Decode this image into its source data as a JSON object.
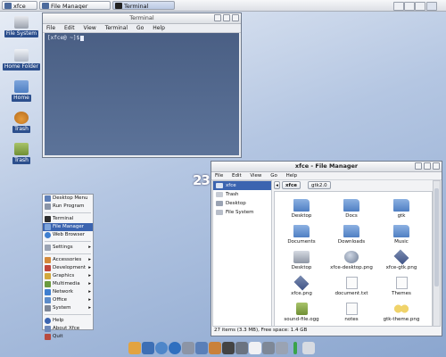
{
  "top_panel": {
    "tasks": [
      {
        "label": "xfce",
        "active": false
      },
      {
        "label": "File Manager",
        "active": false
      },
      {
        "label": "Terminal",
        "active": true
      }
    ]
  },
  "desktop": {
    "icons": [
      {
        "label": "File System",
        "icon": "drive-icon"
      },
      {
        "label": "Home Folder",
        "icon": "home-icon"
      },
      {
        "label": "Home",
        "icon": "folder-icon"
      },
      {
        "label": "Trash",
        "icon": "trash-icon"
      },
      {
        "label": "Trash",
        "icon": "trash-icon"
      }
    ],
    "logo_text": "23"
  },
  "terminal": {
    "title": "Terminal",
    "menu": [
      "File",
      "Edit",
      "View",
      "Terminal",
      "Go",
      "Help"
    ],
    "prompt": "[xfce@ ~]$"
  },
  "app_menu": {
    "items": [
      {
        "label": "Desktop Menu",
        "arrow": false
      },
      {
        "label": "Run Program",
        "arrow": false
      },
      {
        "label": "Terminal",
        "arrow": false
      },
      {
        "label": "File Manager",
        "arrow": false,
        "highlighted": true
      },
      {
        "label": "Web Browser",
        "arrow": false
      },
      {
        "label": "Settings",
        "arrow": true
      },
      {
        "label": "Accessories",
        "arrow": true
      },
      {
        "label": "Development",
        "arrow": true
      },
      {
        "label": "Graphics",
        "arrow": true
      },
      {
        "label": "Multimedia",
        "arrow": true
      },
      {
        "label": "Network",
        "arrow": true
      },
      {
        "label": "Office",
        "arrow": true
      },
      {
        "label": "System",
        "arrow": true
      },
      {
        "label": "Help",
        "arrow": false
      },
      {
        "label": "About Xfce",
        "arrow": false
      },
      {
        "label": "Quit",
        "arrow": false
      }
    ]
  },
  "file_manager": {
    "title": "xfce - File Manager",
    "menu": [
      "File",
      "Edit",
      "View",
      "Go",
      "Help"
    ],
    "sidebar": [
      {
        "label": "xfce",
        "selected": true
      },
      {
        "label": "Trash",
        "selected": false
      },
      {
        "label": "Desktop",
        "selected": false
      },
      {
        "label": "File System",
        "selected": false
      }
    ],
    "path_buttons": [
      "xfce",
      "gtk2.0"
    ],
    "files": [
      {
        "label": "Desktop",
        "type": "folder"
      },
      {
        "label": "Docs",
        "type": "folder"
      },
      {
        "label": "gtk",
        "type": "folder"
      },
      {
        "label": "Documents",
        "type": "folder"
      },
      {
        "label": "Downloads",
        "type": "folder"
      },
      {
        "label": "Music",
        "type": "folder"
      },
      {
        "label": "Desktop",
        "type": "drive"
      },
      {
        "label": "xfce-desktop.png",
        "type": "globe"
      },
      {
        "label": "xfce-gtk.png",
        "type": "diamond"
      },
      {
        "label": "xfce.png",
        "type": "diamond"
      },
      {
        "label": "document.txt",
        "type": "doc"
      },
      {
        "label": "Themes",
        "type": "doc"
      },
      {
        "label": "sound-file.ogg",
        "type": "music"
      },
      {
        "label": "notes",
        "type": "doc"
      },
      {
        "label": "gtk-theme.png",
        "type": "glasses"
      }
    ],
    "status": "27 items (3.3 MB), Free space: 1.4 GB"
  },
  "dock": {
    "icons": [
      "home-icon",
      "terminal-icon",
      "browser-icon",
      "globe-icon",
      "settings-icon",
      "mail-icon",
      "image-icon",
      "clapper-icon",
      "calculator-icon",
      "document-icon",
      "monitor-icon",
      "apps-icon",
      "battery-icon",
      "volume-icon"
    ]
  }
}
